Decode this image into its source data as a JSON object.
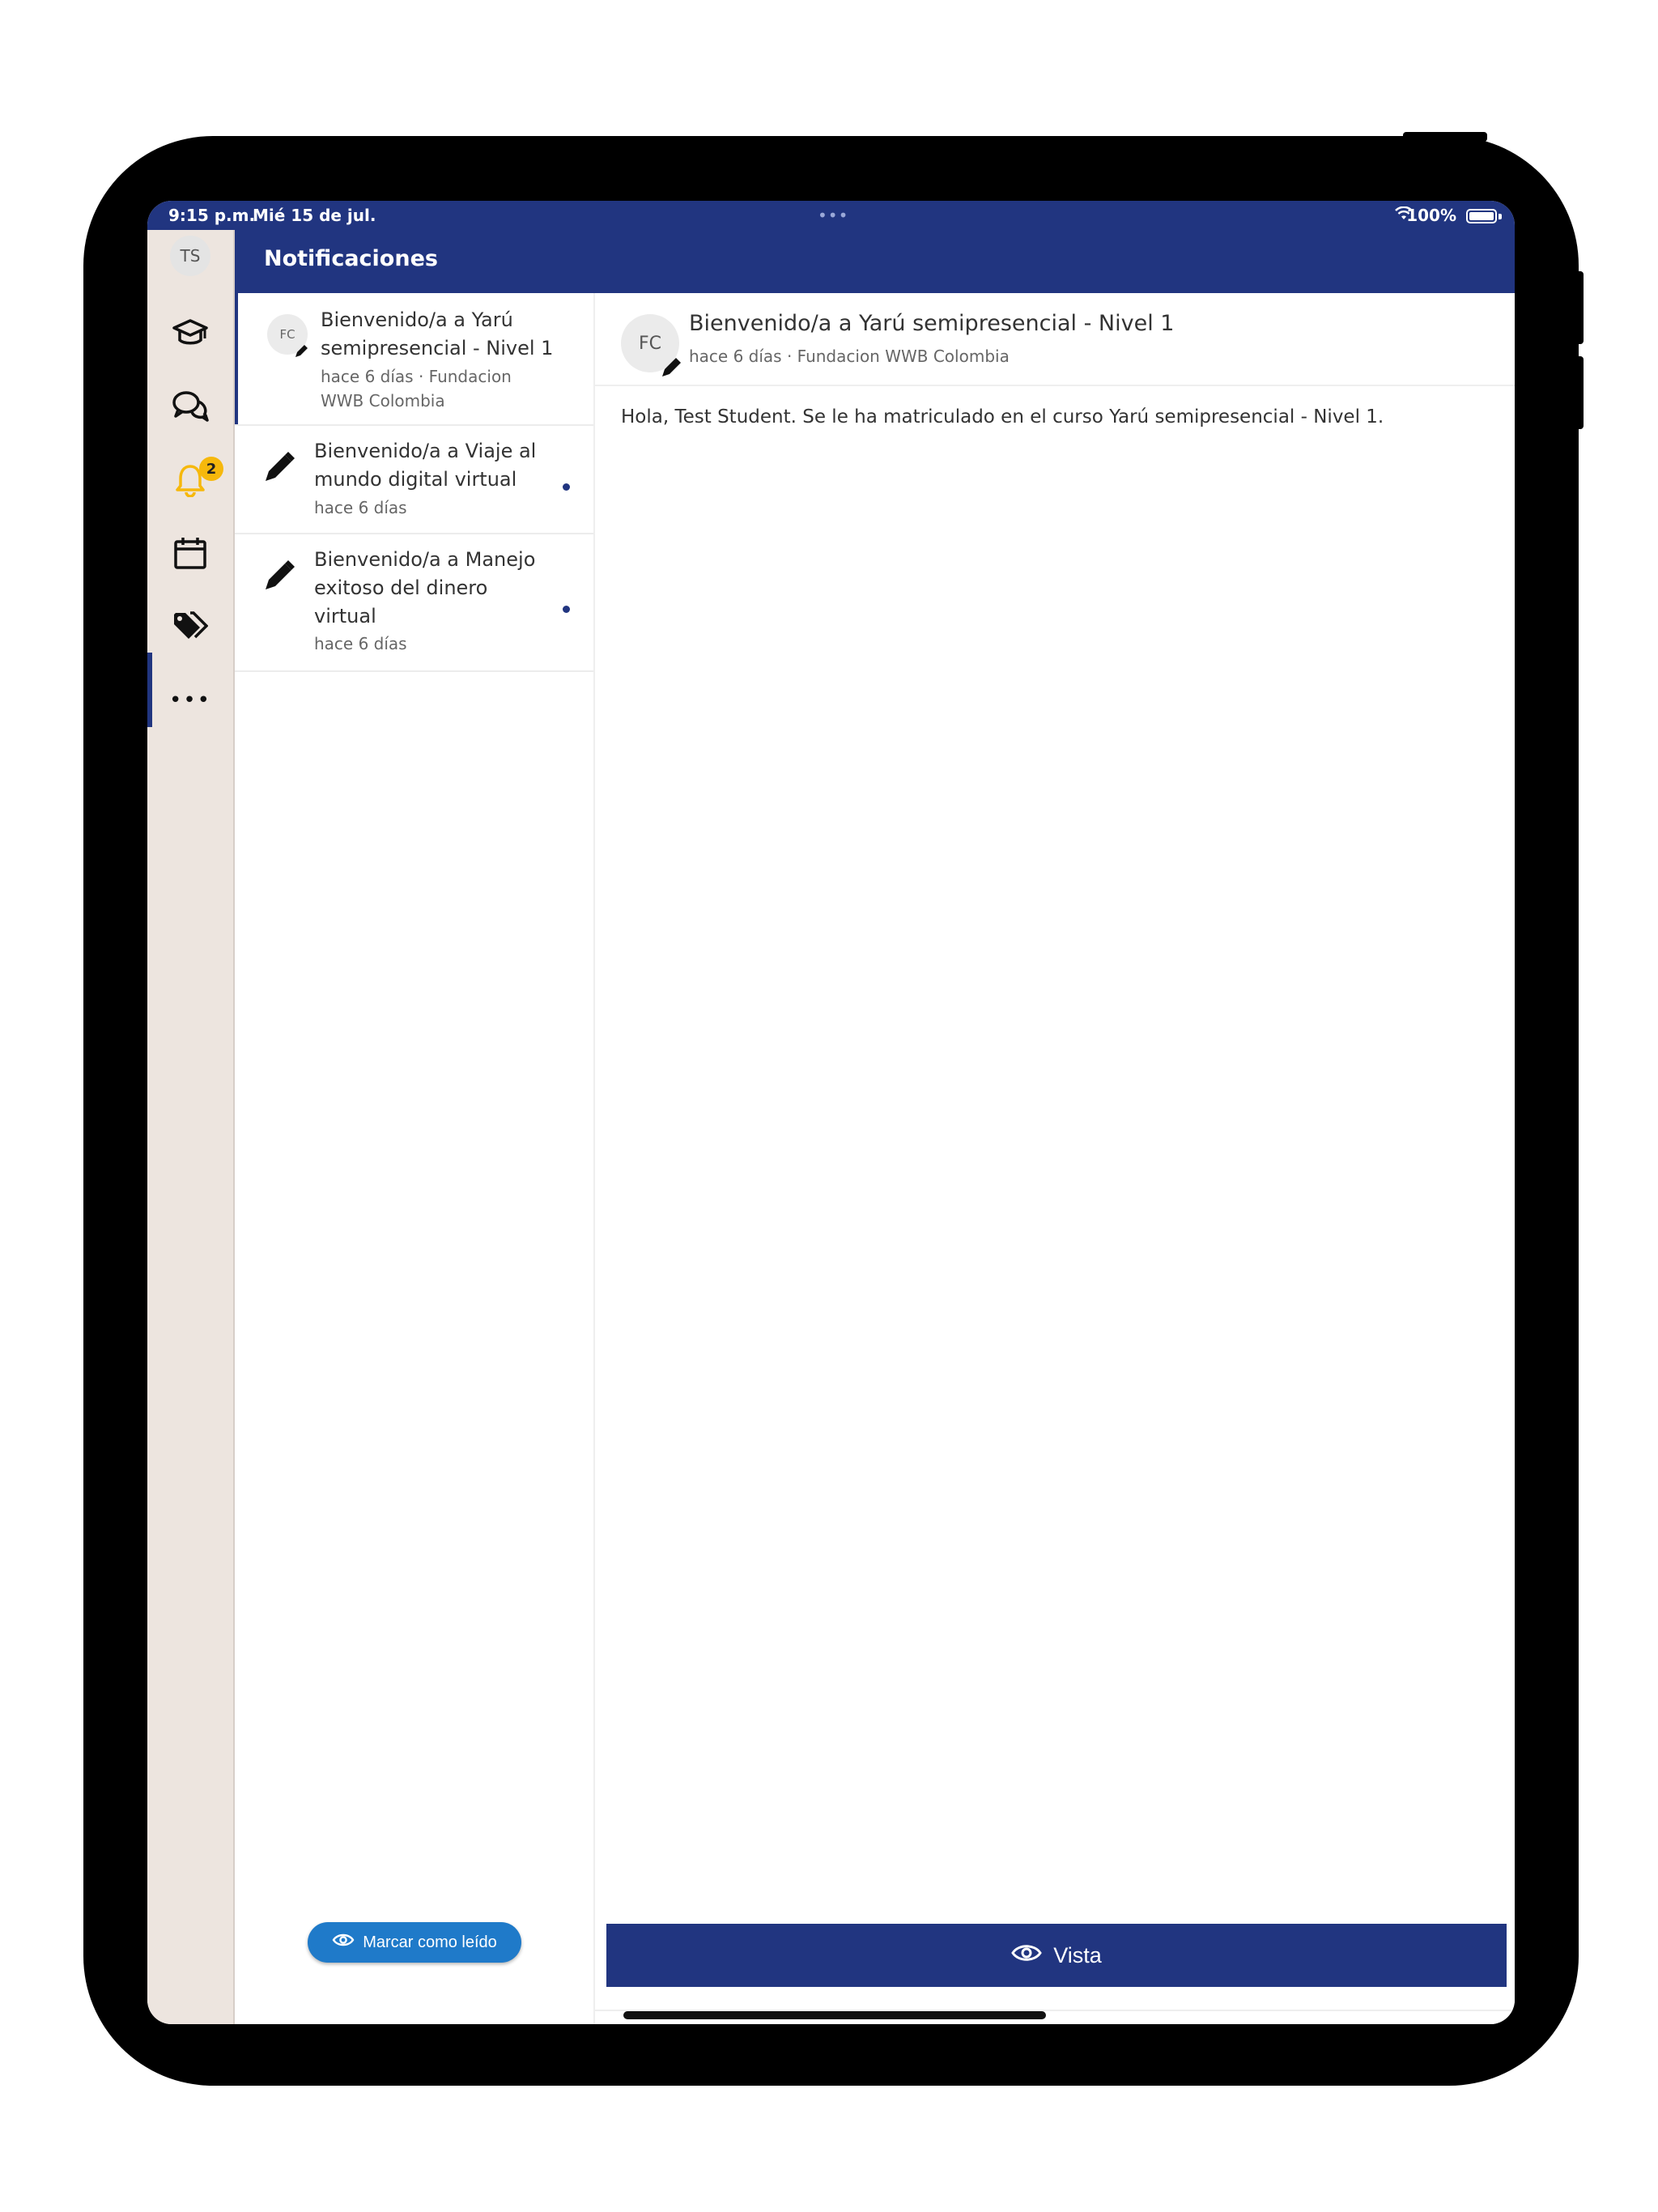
{
  "status_bar": {
    "time": "9:15 p.m.",
    "date": "Mié 15 de jul.",
    "dots": "•••",
    "battery": "100%"
  },
  "rail": {
    "avatar_initials": "TS",
    "notifications_badge": "2",
    "more": "•••"
  },
  "header": {
    "title": "Notificaciones"
  },
  "notifications": [
    {
      "avatar": "FC",
      "title_line1": "Bienvenido/a a Yarú",
      "title_line2": "semipresencial - Nivel 1",
      "meta_line1": "hace 6 días · Fundacion",
      "meta_line2": "WWB Colombia"
    },
    {
      "title_line1": "Bienvenido/a a Viaje al",
      "title_line2": "mundo digital virtual",
      "meta": "hace 6 días"
    },
    {
      "title_line1": "Bienvenido/a a Manejo",
      "title_line2": "exitoso del dinero",
      "title_line3": "virtual",
      "meta": "hace 6 días"
    }
  ],
  "mark_read_label": "Marcar como leído",
  "detail": {
    "avatar": "FC",
    "title": "Bienvenido/a a Yarú semipresencial - Nivel 1",
    "meta": "hace 6 días · Fundacion WWB Colombia",
    "body": "Hola, Test Student. Se le ha matriculado en el curso Yarú semipresencial - Nivel 1."
  },
  "vista_label": "Vista",
  "colors": {
    "primary": "#213580",
    "rail_bg": "#ede5df",
    "badge": "#f6b80c",
    "mark_read": "#1f7ac9"
  }
}
